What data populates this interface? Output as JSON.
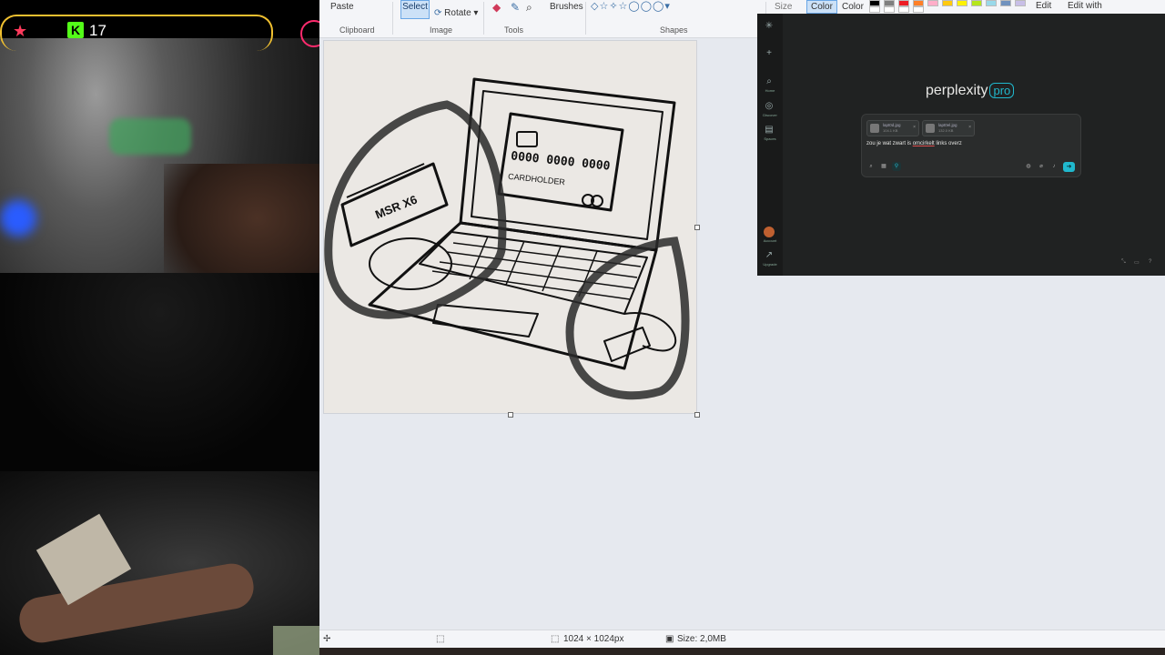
{
  "stream": {
    "viewer_count": "17"
  },
  "ribbon": {
    "paste": "Paste",
    "select": "Select",
    "rotate": "Rotate",
    "brushes": "Brushes",
    "size": "Size",
    "color1": "Color",
    "color2": "Color",
    "edit_colors": "Edit",
    "edit_with": "Edit with",
    "groups": {
      "clipboard": "Clipboard",
      "image": "Image",
      "tools": "Tools",
      "shapes": "Shapes"
    },
    "palette": [
      "#000000",
      "#7f7f7f",
      "#880015",
      "#ed1c24",
      "#ff7f27",
      "#fff200",
      "#22b14c",
      "#00a2e8",
      "#3f48cc",
      "#a349a4",
      "#ffffff"
    ]
  },
  "canvas_drawing": {
    "reader_label": "MSR X6",
    "card_number": "0000 0000 0000",
    "card_holder": "CARDHOLDER"
  },
  "status": {
    "dimensions": "1024 × 1024px",
    "size": "Size: 2,0MB"
  },
  "perplexity": {
    "logo_text": "perplexity",
    "logo_badge": "pro",
    "sidebar": {
      "home": "Home",
      "discover": "Discover",
      "spaces": "Spaces",
      "account": "Account",
      "upgrade": "Upgrade"
    },
    "attachments": [
      {
        "name": "lapt0d.jpg",
        "size": "104.1 KB"
      },
      {
        "name": "lapt0el.jpg",
        "size": "132.0 KB"
      }
    ],
    "prompt_before": "zou je wat zwart is ",
    "prompt_err": "omcirkelt",
    "prompt_after": " links overz"
  }
}
